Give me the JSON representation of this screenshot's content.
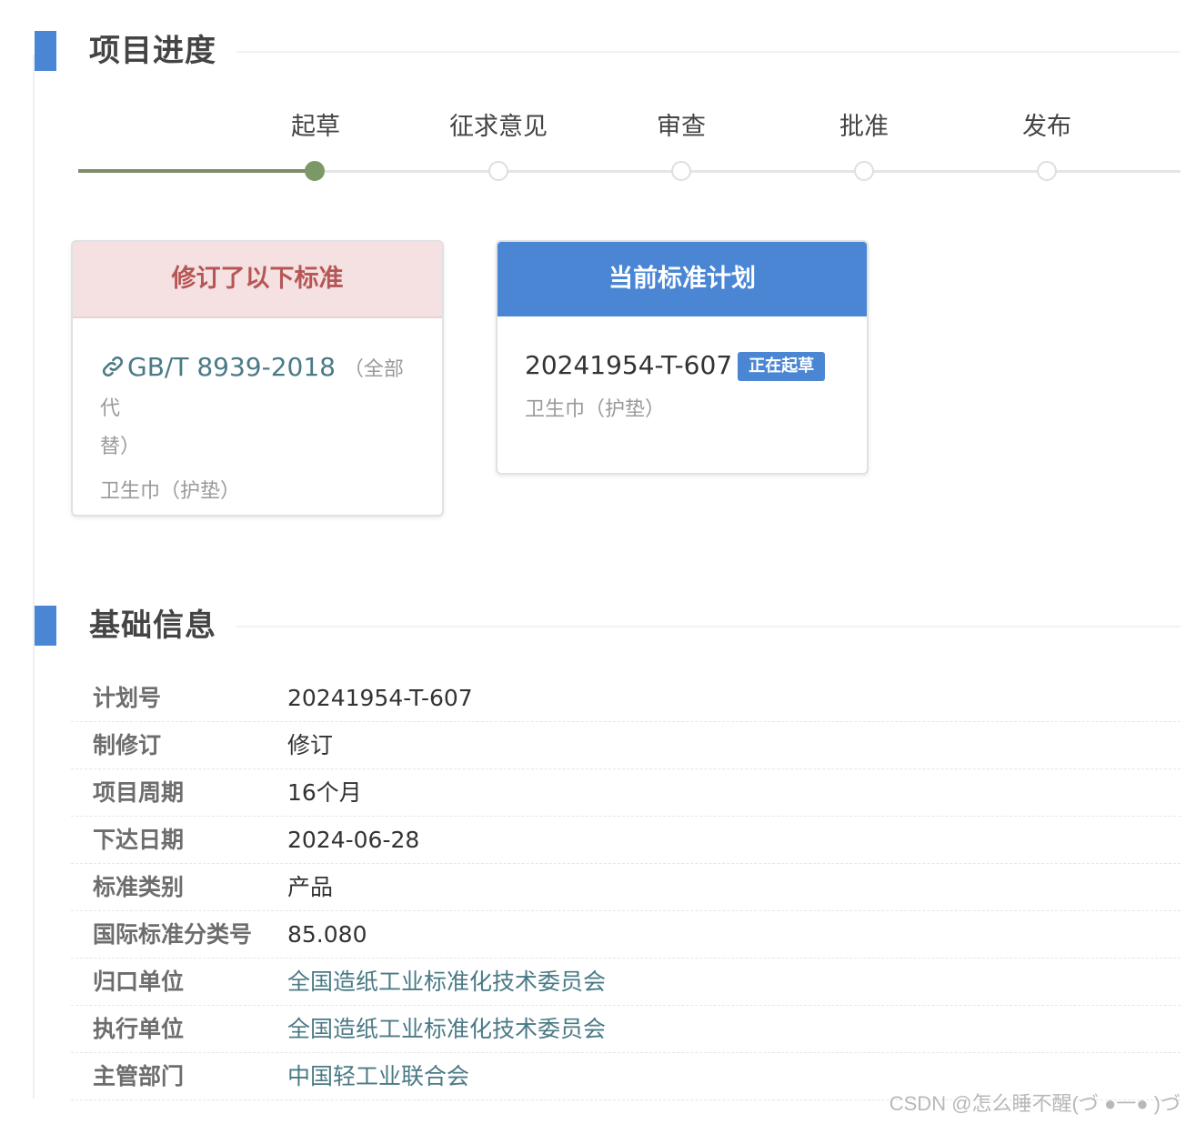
{
  "sections": {
    "progress_title": "项目进度",
    "basic_title": "基础信息"
  },
  "timeline": {
    "steps": [
      {
        "label": "起草",
        "state": "active"
      },
      {
        "label": "征求意见",
        "state": "pending"
      },
      {
        "label": "审查",
        "state": "pending"
      },
      {
        "label": "批准",
        "state": "pending"
      },
      {
        "label": "发布",
        "state": "pending"
      }
    ],
    "active_color": "#7b9966"
  },
  "revised_card": {
    "header": "修订了以下标准",
    "link_icon": "link-icon",
    "standard_code": "GB/T 8939-2018",
    "note_part1": "（全部代",
    "note_part2": "替）",
    "name": "卫生巾（护垫）"
  },
  "plan_card": {
    "header": "当前标准计划",
    "plan_number": "20241954-T-607",
    "status_badge": "正在起草",
    "name": "卫生巾（护垫）"
  },
  "info": {
    "rows": [
      {
        "key": "计划号",
        "value": "20241954-T-607",
        "is_link": false
      },
      {
        "key": "制修订",
        "value": "修订",
        "is_link": false
      },
      {
        "key": "项目周期",
        "value": "16个月",
        "is_link": false
      },
      {
        "key": "下达日期",
        "value": "2024-06-28",
        "is_link": false
      },
      {
        "key": "标准类别",
        "value": "产品",
        "is_link": false
      },
      {
        "key": "国际标准分类号",
        "value": "85.080",
        "is_link": false
      },
      {
        "key": "归口单位",
        "value": "全国造纸工业标准化技术委员会",
        "is_link": true
      },
      {
        "key": "执行单位",
        "value": "全国造纸工业标准化技术委员会",
        "is_link": true
      },
      {
        "key": "主管部门",
        "value": "中国轻工业联合会",
        "is_link": true
      }
    ]
  },
  "watermark": "CSDN @怎么睡不醒(づ ●一● )づ",
  "colors": {
    "accent": "#4a86d4",
    "revised_header_bg": "#f5e1e1",
    "revised_header_text": "#b65656",
    "link_text": "#4a7a86"
  }
}
